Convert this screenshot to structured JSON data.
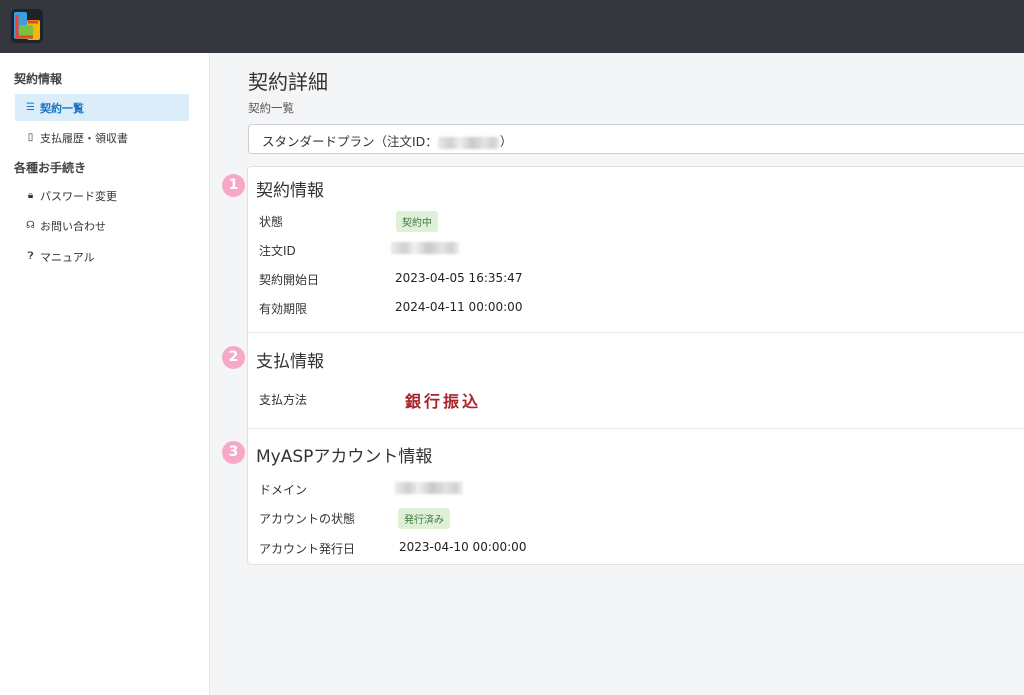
{
  "sidebar": {
    "section1": "契約情報",
    "items1": [
      {
        "icon": "list-icon",
        "label": "契約一覧"
      },
      {
        "icon": "document-icon",
        "label": "支払履歴・領収書"
      }
    ],
    "section2": "各種お手続き",
    "items2": [
      {
        "icon": "lock-icon",
        "label": "パスワード変更"
      },
      {
        "icon": "headset-icon",
        "label": "お問い合わせ"
      },
      {
        "icon": "question-icon",
        "label": "マニュアル"
      }
    ]
  },
  "main": {
    "title": "契約詳細",
    "breadcrumb": "契約一覧",
    "select_prefix": "スタンダードプラン（注文ID：",
    "select_suffix": "）",
    "sections": [
      {
        "number": "1",
        "title": "契約情報",
        "rows": [
          {
            "label": "状態",
            "value": "契約中"
          },
          {
            "label": "注文ID",
            "value": ""
          },
          {
            "label": "契約開始日",
            "value": "2023-04-05 16:35:47"
          },
          {
            "label": "有効期限",
            "value": "2024-04-11 00:00:00"
          }
        ]
      },
      {
        "number": "2",
        "title": "支払情報",
        "rows": [
          {
            "label": "支払方法",
            "value": "銀行振込"
          }
        ]
      },
      {
        "number": "3",
        "title": "MyASPアカウント情報",
        "rows": [
          {
            "label": "ドメイン",
            "value": ""
          },
          {
            "label": "アカウントの状態",
            "value": "発行済み"
          },
          {
            "label": "アカウント発行日",
            "value": "2023-04-10 00:00:00"
          }
        ]
      }
    ]
  },
  "colors": {
    "topbar": "#33363d",
    "active_bg": "#dcedfa",
    "active_text": "#1a74c4",
    "badge_bg": "#dff0d8",
    "badge_text": "#3c7a3c",
    "bank_text": "#a8252c",
    "number_badge": "#f6a8c6"
  }
}
